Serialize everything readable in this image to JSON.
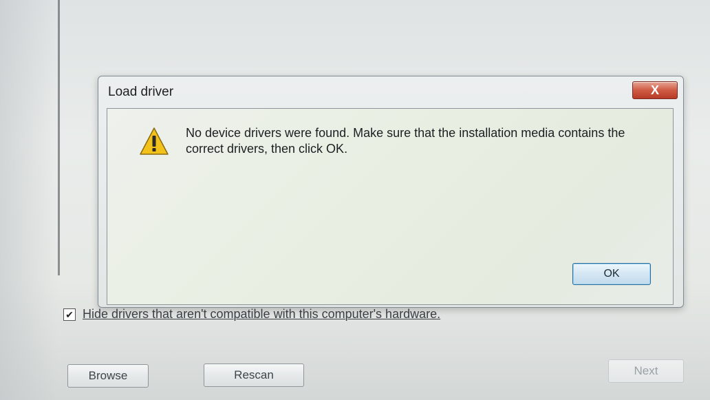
{
  "dialog": {
    "title": "Load driver",
    "close_label": "X",
    "message": "No device drivers were found. Make sure that the installation media contains the correct drivers, then click OK.",
    "ok_label": "OK",
    "icon": "warning-icon"
  },
  "options": {
    "hide_incompatible_label": "Hide drivers that aren't compatible with this computer's hardware.",
    "hide_incompatible_checked": true,
    "check_mark": "✔"
  },
  "buttons": {
    "browse_label": "Browse",
    "rescan_label": "Rescan",
    "next_label": "Next"
  },
  "colors": {
    "close_button": "#cf5b44",
    "ok_border": "#2a6c99",
    "warning_fill": "#f2c21b"
  }
}
